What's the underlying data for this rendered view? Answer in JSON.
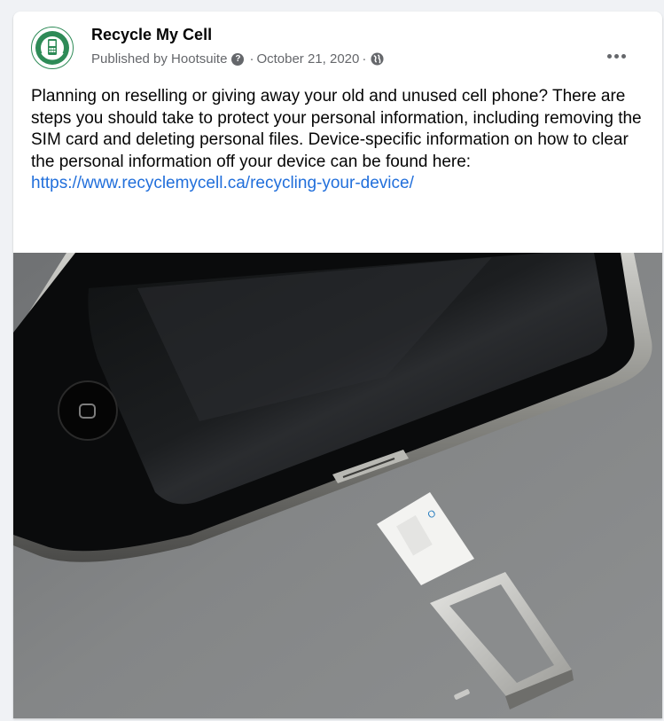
{
  "post": {
    "page_name": "Recycle My Cell",
    "published_by": "Published by Hootsuite",
    "date": "October 21, 2020",
    "body_text": "Planning on reselling or giving away your old and unused cell phone? There are steps you should take to protect your personal information, including removing the SIM card and deleting personal files. Device-specific information on how to clear the personal information off your device can be found here: ",
    "link_text": "https://www.recyclemycell.ca/recycling-your-device/",
    "more_icon": "more-options-icon",
    "privacy_icon": "globe-icon",
    "help_icon": "question-icon"
  },
  "colors": {
    "link": "#216fdb",
    "secondary_text": "#65676b",
    "avatar_green": "#2e8b57"
  },
  "image": {
    "description_icons": [
      "smartphone-image",
      "sim-card-image",
      "sim-tray-image"
    ]
  }
}
